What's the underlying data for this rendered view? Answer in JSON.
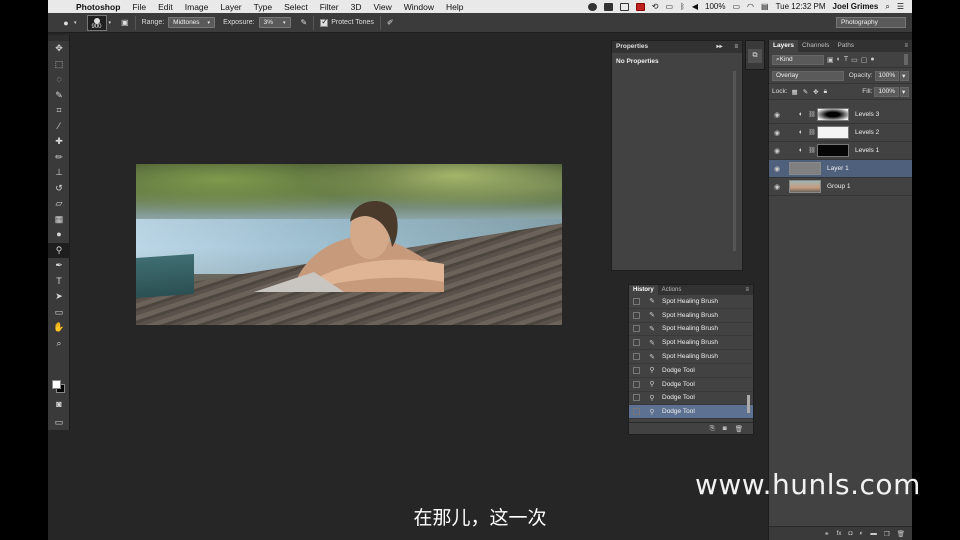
{
  "menubar": {
    "app": "Photoshop",
    "items": [
      "File",
      "Edit",
      "Image",
      "Layer",
      "Type",
      "Select",
      "Filter",
      "3D",
      "View",
      "Window",
      "Help"
    ],
    "battery": "100%",
    "clock": "Tue 12:32 PM",
    "user": "Joel Grimes"
  },
  "options": {
    "brush_size": "900",
    "range_label": "Range:",
    "range_value": "Midtones",
    "exposure_label": "Exposure:",
    "exposure_value": "3%",
    "protect_tones": "Protect Tones",
    "workspace": "Photography"
  },
  "tools": [
    "move-tool",
    "marquee-tool",
    "lasso-tool",
    "quick-selection-tool",
    "crop-tool",
    "eyedropper-tool",
    "spot-healing-tool",
    "brush-tool",
    "clone-stamp-tool",
    "history-brush-tool",
    "eraser-tool",
    "gradient-tool",
    "blur-tool",
    "dodge-tool",
    "pen-tool",
    "type-tool",
    "path-selection-tool",
    "rectangle-tool",
    "hand-tool",
    "zoom-tool"
  ],
  "properties": {
    "title": "Properties",
    "body": "No Properties"
  },
  "layers_panel": {
    "tabs": [
      "Layers",
      "Channels",
      "Paths"
    ],
    "filter": "Kind",
    "blend_mode": "Overlay",
    "opacity_label": "Opacity:",
    "opacity": "100%",
    "lock_label": "Lock:",
    "fill_label": "Fill:",
    "fill": "100%",
    "layers": [
      {
        "name": "Levels 3",
        "type": "adjustment"
      },
      {
        "name": "Levels 2",
        "type": "adjustment"
      },
      {
        "name": "Levels 1",
        "type": "adjustment"
      },
      {
        "name": "Layer 1",
        "type": "pixel"
      },
      {
        "name": "Group 1",
        "type": "group"
      }
    ],
    "selected_layer": "Layer 1"
  },
  "history_panel": {
    "tabs": [
      "History",
      "Actions"
    ],
    "items": [
      "Spot Healing Brush",
      "Spot Healing Brush",
      "Spot Healing Brush",
      "Spot Healing Brush",
      "Spot Healing Brush",
      "Dodge Tool",
      "Dodge Tool",
      "Dodge Tool",
      "Dodge Tool"
    ],
    "selected_index": 8
  },
  "watermark": "www.hunls.com",
  "subtitle": "在那儿，这一次",
  "colors": {
    "ui_bg": "#262626",
    "panel_bg": "#424242",
    "selection": "#4f607c"
  }
}
